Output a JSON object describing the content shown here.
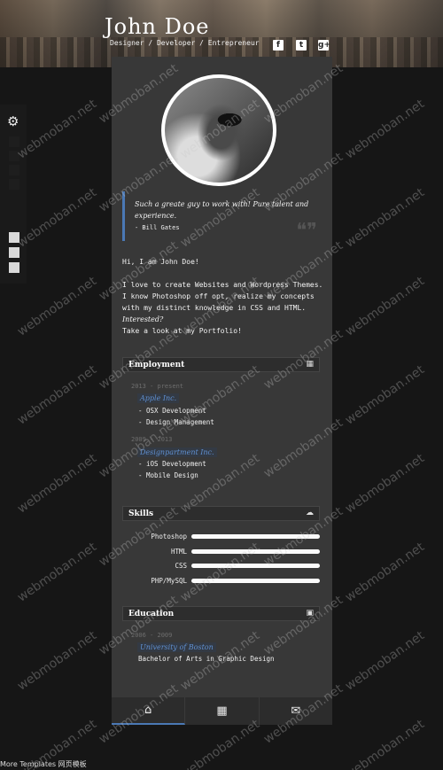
{
  "header": {
    "name": "John Doe",
    "tagline": "Designer / Developer / Entrepreneur",
    "social": [
      {
        "icon": "facebook-icon",
        "glyph": "f"
      },
      {
        "icon": "twitter-icon",
        "glyph": "t"
      },
      {
        "icon": "google-plus-icon",
        "glyph": "g+"
      }
    ]
  },
  "settings": {
    "icon": "gears-icon",
    "glyph": "⚙"
  },
  "quote": {
    "text": "Such a greate guy to work with! Pure talent and experience.",
    "author": "- Bill Gates",
    "mark": "❝❞"
  },
  "intro": {
    "greeting": "Hi, I am John Doe!",
    "line1": "I love to create Websites and Wordpress Themes.",
    "line2": "I know Photoshop off opt, realize my concepts with my distinct knowledge in CSS and HTML.",
    "line3": "Interested?",
    "line4": "Take a look at my Portfolio!"
  },
  "employment": {
    "title": "Employment",
    "icon_glyph": "▦",
    "jobs": [
      {
        "years": "2013 - present",
        "company": "Apple Inc.",
        "duties": [
          "- OSX Development",
          "- Design Management"
        ]
      },
      {
        "years": "2009 - 2013",
        "company": "Designpartment Inc.",
        "duties": [
          "- iOS Development",
          "- Mobile Design"
        ]
      }
    ]
  },
  "skills": {
    "title": "Skills",
    "icon_glyph": "☁",
    "items": [
      {
        "label": "Photoshop",
        "level": 1.0
      },
      {
        "label": "HTML",
        "level": 1.0
      },
      {
        "label": "CSS",
        "level": 1.0
      },
      {
        "label": "PHP/MySQL",
        "level": 1.0
      }
    ]
  },
  "education": {
    "title": "Education",
    "icon_glyph": "▣",
    "years": "2006 - 2009",
    "school": "University of Boston",
    "degree": "Bachelor of Arts in Graphic Design"
  },
  "nav": {
    "home": "⌂",
    "portfolio": "▦",
    "contact": "✉"
  },
  "footer": {
    "text": "More Templates 网页模板"
  },
  "watermark": "webmoban.net"
}
